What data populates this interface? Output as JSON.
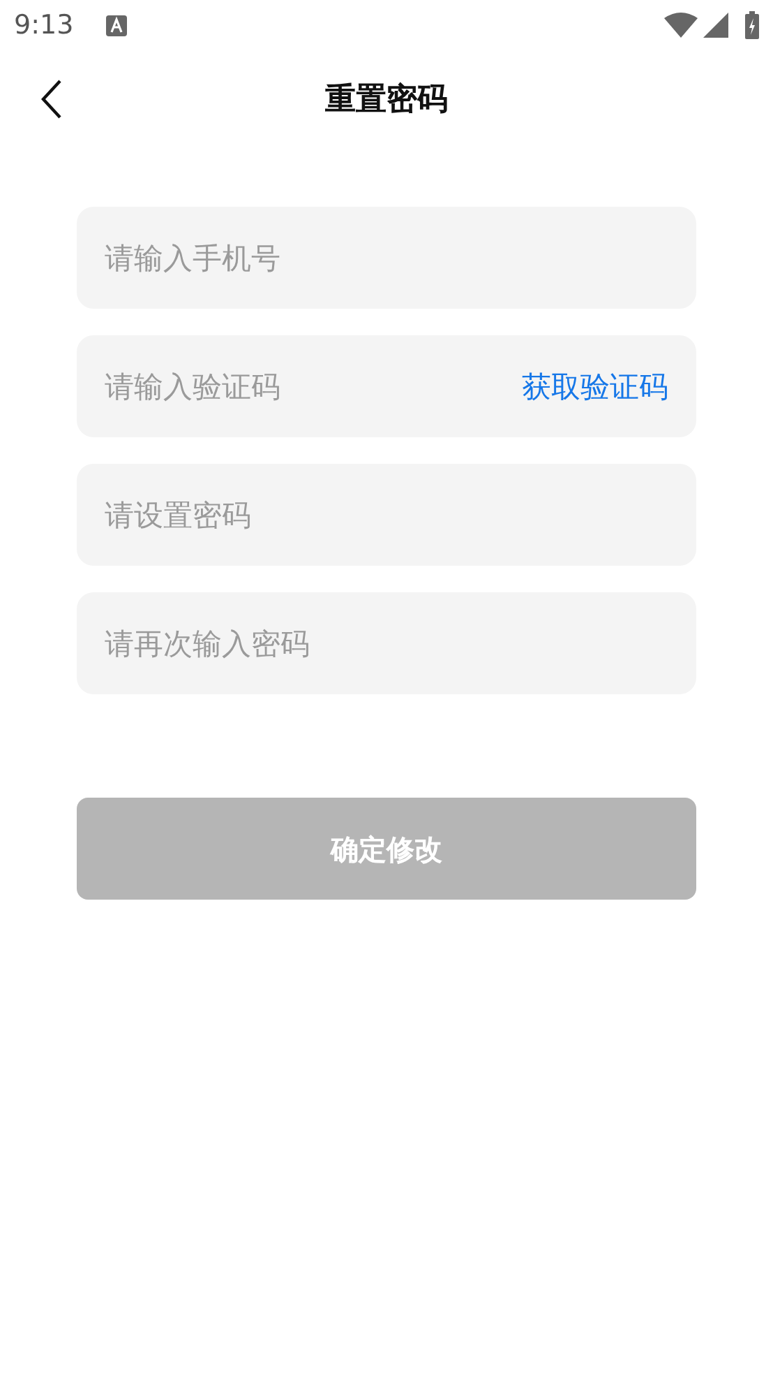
{
  "status_bar": {
    "time": "9:13"
  },
  "header": {
    "title": "重置密码"
  },
  "fields": [
    {
      "placeholder": "请输入手机号"
    },
    {
      "placeholder": "请输入验证码",
      "action": "获取验证码"
    },
    {
      "placeholder": "请设置密码"
    },
    {
      "placeholder": "请再次输入密码"
    }
  ],
  "submit": {
    "label": "确定修改",
    "disabled": true
  }
}
